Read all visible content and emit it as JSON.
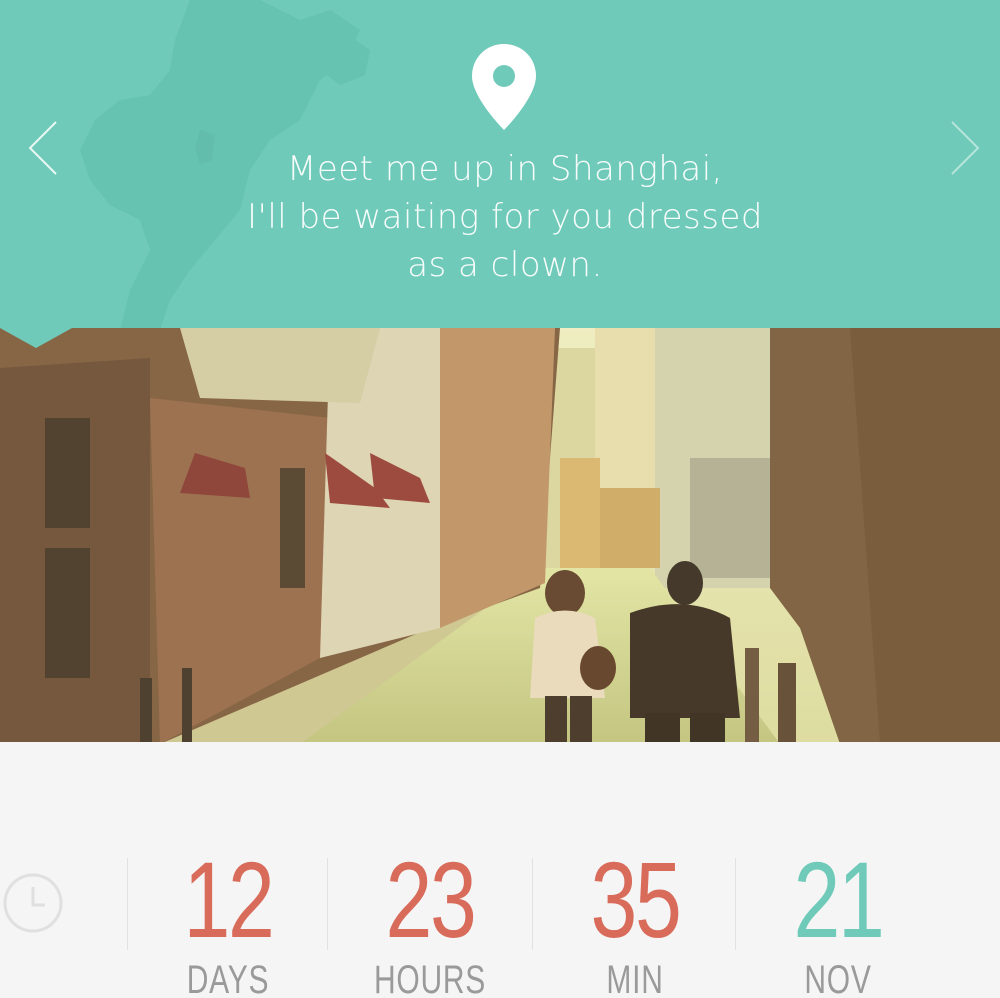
{
  "header": {
    "background": "#6fcab9",
    "pin_icon": "location-pin-icon",
    "quote_lines": [
      "Meet me up in Shanghai,",
      "I'll be waiting for you dressed",
      "as a clown."
    ],
    "prev_icon": "chevron-left-icon",
    "next_icon": "chevron-right-icon"
  },
  "photo": {
    "description_icon": "street-photo"
  },
  "countdown": {
    "clock_icon": "clock-icon",
    "accent_red": "#d96b5b",
    "accent_teal": "#6fcab9",
    "items": [
      {
        "value": "12",
        "label": "DAYS"
      },
      {
        "value": "23",
        "label": "HOURS"
      },
      {
        "value": "35",
        "label": "MIN"
      },
      {
        "value": "21",
        "label": "NOV"
      }
    ]
  }
}
